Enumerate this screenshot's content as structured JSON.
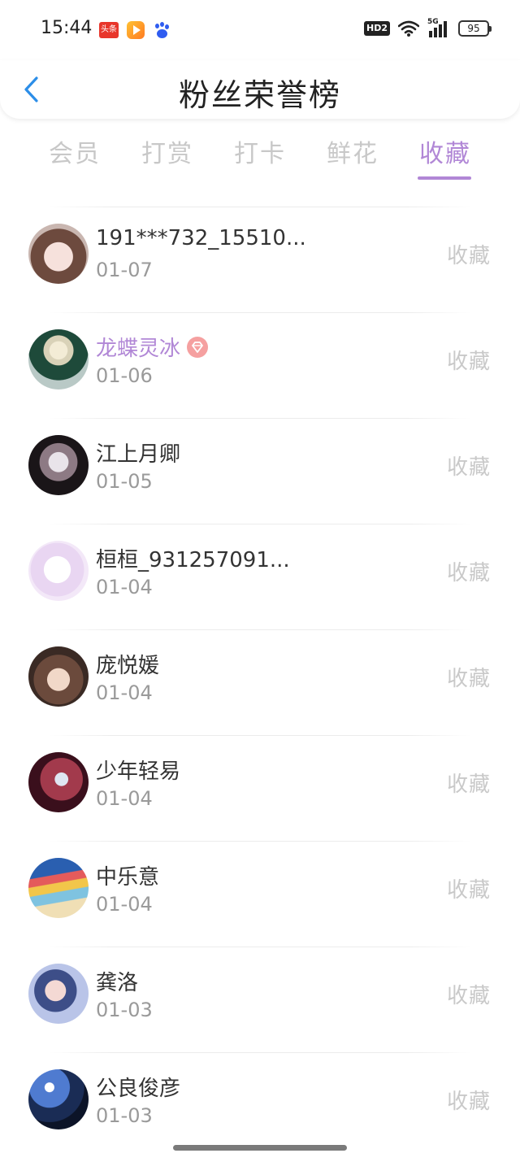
{
  "status_bar": {
    "time": "15:44",
    "app_icons": [
      "toutiao-icon",
      "video-app-icon",
      "baidu-icon"
    ],
    "app_toutiao_label": "头条",
    "hd_label": "HD2",
    "network_label": "5G",
    "battery": "95"
  },
  "header": {
    "title": "粉丝荣誉榜",
    "back_icon": "chevron-left-icon"
  },
  "tabs": [
    {
      "label": "会员"
    },
    {
      "label": "打赏"
    },
    {
      "label": "打卡"
    },
    {
      "label": "鲜花"
    },
    {
      "label": "收藏"
    }
  ],
  "active_tab": "收藏",
  "colors": {
    "accent": "#b187d6",
    "back_arrow": "#2c8ee8",
    "vip_badge": "#f5a0a0",
    "inactive_tab": "#c8c8c8"
  },
  "fans": [
    {
      "name": "191***732_15510...",
      "date": "01-07",
      "action": "收藏",
      "vip": false
    },
    {
      "name": "龙蝶灵冰",
      "date": "01-06",
      "action": "收藏",
      "vip": true,
      "badge_icon": "diamond-icon"
    },
    {
      "name": "江上月卿",
      "date": "01-05",
      "action": "收藏",
      "vip": false
    },
    {
      "name": "桓桓_931257091...",
      "date": "01-04",
      "action": "收藏",
      "vip": false
    },
    {
      "name": "庞悦媛",
      "date": "01-04",
      "action": "收藏",
      "vip": false
    },
    {
      "name": "少年轻易",
      "date": "01-04",
      "action": "收藏",
      "vip": false
    },
    {
      "name": "中乐意",
      "date": "01-04",
      "action": "收藏",
      "vip": false
    },
    {
      "name": "龚洛",
      "date": "01-03",
      "action": "收藏",
      "vip": false
    },
    {
      "name": "公良俊彦",
      "date": "01-03",
      "action": "收藏",
      "vip": false
    }
  ]
}
